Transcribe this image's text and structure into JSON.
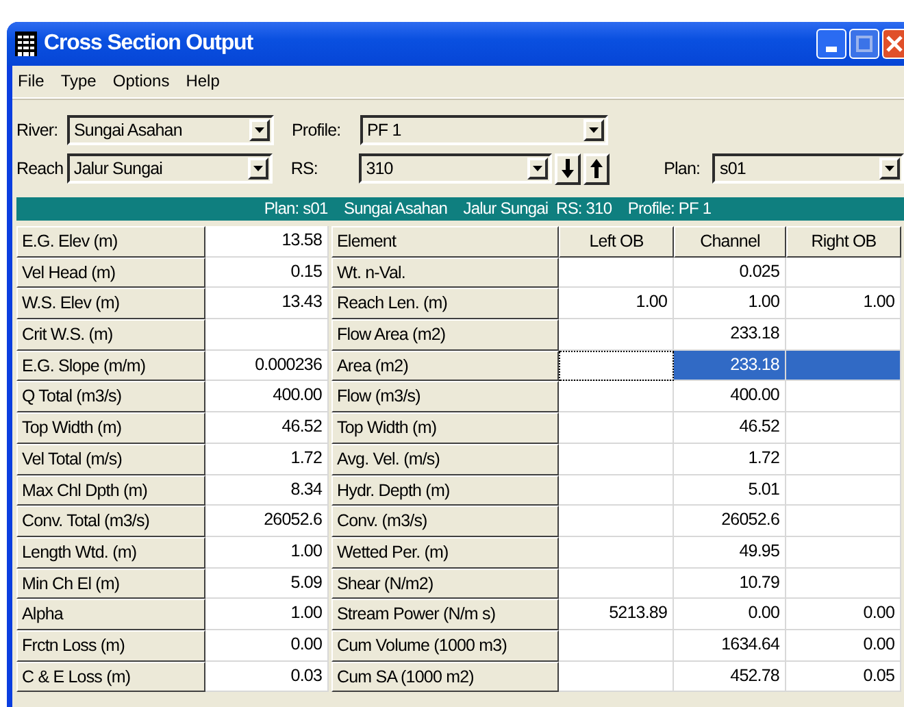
{
  "window": {
    "title": "Cross Section Output"
  },
  "menu": [
    "File",
    "Type",
    "Options",
    "Help"
  ],
  "selectors": {
    "river": {
      "label": "River:",
      "value": "Sungai Asahan"
    },
    "profile": {
      "label": "Profile:",
      "value": "PF 1"
    },
    "reach": {
      "label": "Reach",
      "value": "Jalur Sungai"
    },
    "rs": {
      "label": "RS:",
      "value": "310"
    },
    "plan": {
      "label": "Plan:",
      "value": "s01"
    }
  },
  "banner": "Plan: s01    Sungai Asahan    Jalur Sungai  RS: 310    Profile: PF 1",
  "summary_table": {
    "rows": [
      {
        "label": "E.G. Elev (m)",
        "value": "13.58"
      },
      {
        "label": "Vel Head (m)",
        "value": "0.15"
      },
      {
        "label": "W.S. Elev (m)",
        "value": "13.43"
      },
      {
        "label": "Crit W.S. (m)"
      },
      {
        "label": "E.G. Slope (m/m)",
        "value": "0.000236"
      },
      {
        "label": "Q Total (m3/s)",
        "value": "400.00"
      },
      {
        "label": "Top Width (m)",
        "value": "46.52"
      },
      {
        "label": "Vel Total (m/s)",
        "value": "1.72"
      },
      {
        "label": "Max Chl Dpth (m)",
        "value": "8.34"
      },
      {
        "label": "Conv. Total (m3/s)",
        "value": "26052.6"
      },
      {
        "label": "Length Wtd. (m)",
        "value": "1.00"
      },
      {
        "label": "Min Ch El (m)",
        "value": "5.09"
      },
      {
        "label": "Alpha",
        "value": "1.00"
      },
      {
        "label": "Frctn Loss (m)",
        "value": "0.00"
      },
      {
        "label": "C & E Loss (m)",
        "value": "0.03"
      }
    ]
  },
  "element_table": {
    "columns": [
      "Element",
      "Left OB",
      "Channel",
      "Right OB"
    ],
    "rows": [
      {
        "label": "Wt. n-Val.",
        "cells": [
          null,
          "0.025",
          null
        ],
        "selected": false
      },
      {
        "label": "Reach Len. (m)",
        "cells": [
          "1.00",
          "1.00",
          "1.00"
        ],
        "selected": false
      },
      {
        "label": "Flow Area (m2)",
        "cells": [
          null,
          "233.18",
          null
        ],
        "selected": false
      },
      {
        "label": "Area (m2)",
        "cells": [
          null,
          "233.18",
          null
        ],
        "selected": true
      },
      {
        "label": "Flow (m3/s)",
        "cells": [
          null,
          "400.00",
          null
        ],
        "selected": false
      },
      {
        "label": "Top Width (m)",
        "cells": [
          null,
          "46.52",
          null
        ],
        "selected": false
      },
      {
        "label": "Avg. Vel. (m/s)",
        "cells": [
          null,
          "1.72",
          null
        ],
        "selected": false
      },
      {
        "label": "Hydr. Depth (m)",
        "cells": [
          null,
          "5.01",
          null
        ],
        "selected": false
      },
      {
        "label": "Conv. (m3/s)",
        "cells": [
          null,
          "26052.6",
          null
        ],
        "selected": false
      },
      {
        "label": "Wetted Per. (m)",
        "cells": [
          null,
          "49.95",
          null
        ],
        "selected": false
      },
      {
        "label": "Shear (N/m2)",
        "cells": [
          null,
          "10.79",
          null
        ],
        "selected": false
      },
      {
        "label": "Stream Power (N/m s)",
        "cells": [
          "5213.89",
          "0.00",
          "0.00"
        ],
        "selected": false
      },
      {
        "label": "Cum Volume (1000 m3)",
        "cells": [
          null,
          "1634.64",
          "0.00"
        ],
        "selected": false
      },
      {
        "label": "Cum SA (1000 m2)",
        "cells": [
          null,
          "452.78",
          "0.05"
        ],
        "selected": false
      }
    ]
  }
}
